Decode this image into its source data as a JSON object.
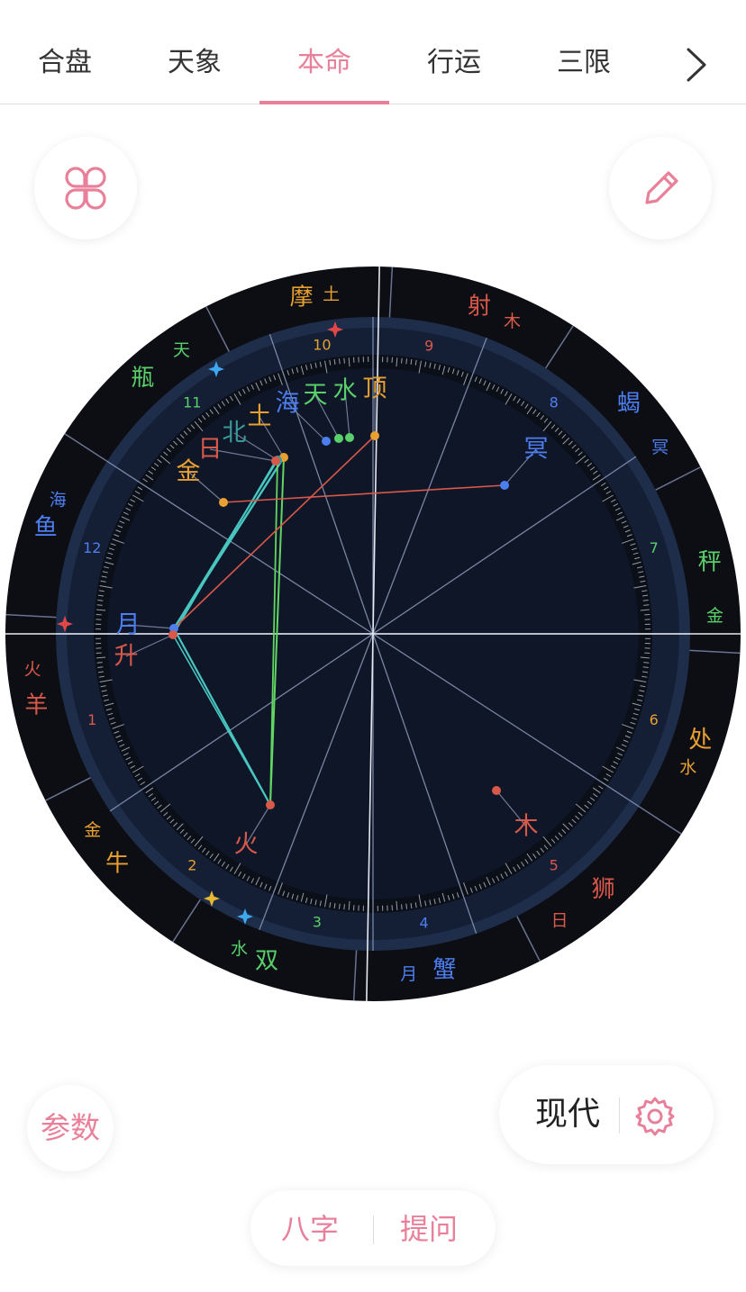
{
  "tabs": [
    {
      "label": "合盘",
      "active": false
    },
    {
      "label": "天象",
      "active": false
    },
    {
      "label": "本命",
      "active": true
    },
    {
      "label": "行运",
      "active": false
    },
    {
      "label": "三限",
      "active": false
    }
  ],
  "icons": {
    "more": "chevron-right-icon",
    "grid": "clover-grid-icon",
    "edit": "pencil-icon",
    "settings": "gear-icon"
  },
  "colors": {
    "accent": "#e8809a",
    "chart_bg": "#0f1628",
    "ring_bg": "#0c0e14",
    "fire": "#d8584a",
    "earth": "#e8a030",
    "air": "#5ad06a",
    "water": "#4d7ef0"
  },
  "signs": [
    {
      "label": "射",
      "ruler": "木",
      "color": "#d8584a"
    },
    {
      "label": "蝎",
      "ruler": "冥",
      "color": "#4d7ef0"
    },
    {
      "label": "秤",
      "ruler": "金",
      "color": "#5ad06a"
    },
    {
      "label": "处",
      "ruler": "水",
      "color": "#e8a030"
    },
    {
      "label": "狮",
      "ruler": "日",
      "color": "#d8584a"
    },
    {
      "label": "蟹",
      "ruler": "月",
      "color": "#4d7ef0"
    },
    {
      "label": "双",
      "ruler": "水",
      "color": "#5ad06a"
    },
    {
      "label": "牛",
      "ruler": "金",
      "color": "#e8a030"
    },
    {
      "label": "羊",
      "ruler": "火",
      "color": "#d8584a"
    },
    {
      "label": "鱼",
      "ruler": "海",
      "color": "#4d7ef0"
    },
    {
      "label": "瓶",
      "ruler": "天",
      "color": "#5ad06a"
    },
    {
      "label": "摩",
      "ruler": "土",
      "color": "#e8a030"
    }
  ],
  "houses": [
    "1",
    "2",
    "3",
    "4",
    "5",
    "6",
    "7",
    "8",
    "9",
    "10",
    "11",
    "12"
  ],
  "planets": [
    {
      "label": "顶",
      "color": "#e8a030"
    },
    {
      "label": "水",
      "color": "#5ad06a"
    },
    {
      "label": "天",
      "color": "#5ad06a"
    },
    {
      "label": "海",
      "color": "#4d7ef0"
    },
    {
      "label": "土",
      "color": "#e8a030"
    },
    {
      "label": "北",
      "color": "#3a9a9a"
    },
    {
      "label": "日",
      "color": "#d8584a"
    },
    {
      "label": "金",
      "color": "#e8a030"
    },
    {
      "label": "冥",
      "color": "#4d7ef0"
    },
    {
      "label": "月",
      "color": "#4d7ef0"
    },
    {
      "label": "升",
      "color": "#d8584a"
    },
    {
      "label": "火",
      "color": "#d8584a"
    },
    {
      "label": "木",
      "color": "#d8584a"
    }
  ],
  "mode": {
    "label": "现代"
  },
  "params": {
    "label": "参数"
  },
  "bottom": {
    "bazi": "八字",
    "ask": "提问"
  }
}
